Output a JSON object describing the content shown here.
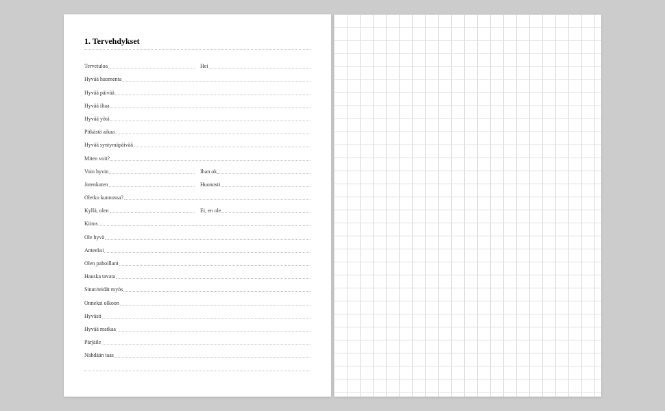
{
  "heading": "1. Tervehdykset",
  "rows": [
    {
      "type": "double",
      "left": "Tervetuloa",
      "right": "Hei"
    },
    {
      "type": "single",
      "left": "Hyvää huomenta"
    },
    {
      "type": "single",
      "left": "Hyvää päivää"
    },
    {
      "type": "single",
      "left": "Hyvää iltaa"
    },
    {
      "type": "single",
      "left": "Hyvää yötä"
    },
    {
      "type": "single",
      "left": "Pitkästä aikaa"
    },
    {
      "type": "single",
      "left": "Hyvää syntymäpäivää"
    },
    {
      "type": "single",
      "left": "Miten voit?"
    },
    {
      "type": "double",
      "left": "Voin hyvin",
      "right": "Ihan ok"
    },
    {
      "type": "double",
      "left": "Jotenkuten",
      "right": "Huonosti"
    },
    {
      "type": "single",
      "left": "Oletko kunnossa?"
    },
    {
      "type": "double",
      "left": "Kyllä, olen",
      "right": "Ei, en ole"
    },
    {
      "type": "single",
      "left": "Kiitos"
    },
    {
      "type": "single",
      "left": "Ole hyvä"
    },
    {
      "type": "single",
      "left": "Anteeksi"
    },
    {
      "type": "single",
      "left": "Olen pahoillani"
    },
    {
      "type": "single",
      "left": "Hauska tavata"
    },
    {
      "type": "single",
      "left": "Sinut/teidät myös"
    },
    {
      "type": "single",
      "left": "Onneksi olkoon"
    },
    {
      "type": "single",
      "left": "Hyvästi"
    },
    {
      "type": "single",
      "left": "Hyvää matkaa"
    },
    {
      "type": "single",
      "left": "Pärjäile"
    },
    {
      "type": "single",
      "left": "Nähdään taas"
    },
    {
      "type": "blank"
    }
  ]
}
